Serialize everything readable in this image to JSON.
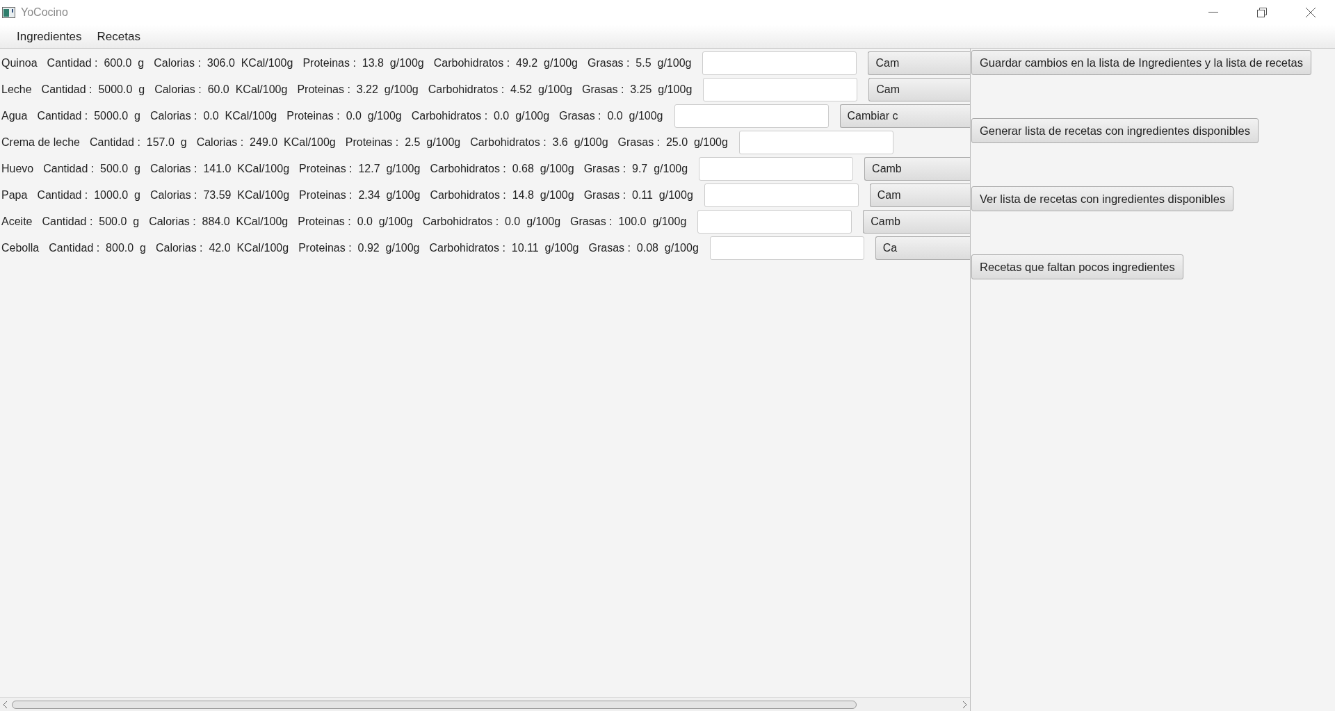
{
  "window": {
    "title": "YoCocino"
  },
  "menu": [
    "Ingredientes",
    "Recetas"
  ],
  "ingredients": [
    {
      "name": "Quinoa",
      "fields": [
        {
          "label": "Cantidad :",
          "value": "600.0",
          "unit": "g"
        },
        {
          "label": "Calorias :",
          "value": "306.0",
          "unit": "KCal/100g"
        },
        {
          "label": "Proteinas :",
          "value": "13.8",
          "unit": "g/100g"
        },
        {
          "label": "Carbohidratos :",
          "value": "49.2",
          "unit": "g/100g"
        },
        {
          "label": "Grasas :",
          "value": "5.5",
          "unit": "g/100g"
        }
      ],
      "button": "Cam"
    },
    {
      "name": "Leche",
      "fields": [
        {
          "label": "Cantidad :",
          "value": "5000.0",
          "unit": "g"
        },
        {
          "label": "Calorias :",
          "value": "60.0",
          "unit": "KCal/100g"
        },
        {
          "label": "Proteinas :",
          "value": "3.22",
          "unit": "g/100g"
        },
        {
          "label": "Carbohidratos :",
          "value": "4.52",
          "unit": "g/100g"
        },
        {
          "label": "Grasas :",
          "value": "3.25",
          "unit": "g/100g"
        }
      ],
      "button": "Cam"
    },
    {
      "name": "Agua",
      "fields": [
        {
          "label": "Cantidad :",
          "value": "5000.0",
          "unit": "g"
        },
        {
          "label": "Calorias :",
          "value": "0.0",
          "unit": "KCal/100g"
        },
        {
          "label": "Proteinas :",
          "value": "0.0",
          "unit": "g/100g"
        },
        {
          "label": "Carbohidratos :",
          "value": "0.0",
          "unit": "g/100g"
        },
        {
          "label": "Grasas :",
          "value": "0.0",
          "unit": "g/100g"
        }
      ],
      "button": "Cambiar c"
    },
    {
      "name": "Crema de leche",
      "fields": [
        {
          "label": "Cantidad :",
          "value": "157.0",
          "unit": "g"
        },
        {
          "label": "Calorias :",
          "value": "249.0",
          "unit": "KCal/100g"
        },
        {
          "label": "Proteinas :",
          "value": "2.5",
          "unit": "g/100g"
        },
        {
          "label": "Carbohidratos :",
          "value": "3.6",
          "unit": "g/100g"
        },
        {
          "label": "Grasas :",
          "value": "25.0",
          "unit": "g/100g"
        }
      ]
    },
    {
      "name": "Huevo",
      "fields": [
        {
          "label": "Cantidad :",
          "value": "500.0",
          "unit": "g"
        },
        {
          "label": "Calorias :",
          "value": "141.0",
          "unit": "KCal/100g"
        },
        {
          "label": "Proteinas :",
          "value": "12.7",
          "unit": "g/100g"
        },
        {
          "label": "Carbohidratos :",
          "value": "0.68",
          "unit": "g/100g"
        },
        {
          "label": "Grasas :",
          "value": "9.7",
          "unit": "g/100g"
        }
      ],
      "button": "Camb"
    },
    {
      "name": "Papa",
      "fields": [
        {
          "label": "Cantidad :",
          "value": "1000.0",
          "unit": "g"
        },
        {
          "label": "Calorias :",
          "value": "73.59",
          "unit": "KCal/100g"
        },
        {
          "label": "Proteinas :",
          "value": "2.34",
          "unit": "g/100g"
        },
        {
          "label": "Carbohidratos :",
          "value": "14.8",
          "unit": "g/100g"
        },
        {
          "label": "Grasas :",
          "value": "0.11",
          "unit": "g/100g"
        }
      ],
      "button": "Cam"
    },
    {
      "name": "Aceite",
      "fields": [
        {
          "label": "Cantidad :",
          "value": "500.0",
          "unit": "g"
        },
        {
          "label": "Calorias :",
          "value": "884.0",
          "unit": "KCal/100g"
        },
        {
          "label": "Proteinas :",
          "value": "0.0",
          "unit": "g/100g"
        },
        {
          "label": "Carbohidratos :",
          "value": "0.0",
          "unit": "g/100g"
        },
        {
          "label": "Grasas :",
          "value": "100.0",
          "unit": "g/100g"
        }
      ],
      "button": "Camb"
    },
    {
      "name": "Cebolla",
      "fields": [
        {
          "label": "Cantidad :",
          "value": "800.0",
          "unit": "g"
        },
        {
          "label": "Calorias :",
          "value": "42.0",
          "unit": "KCal/100g"
        },
        {
          "label": "Proteinas :",
          "value": "0.92",
          "unit": "g/100g"
        },
        {
          "label": "Carbohidratos :",
          "value": "10.11",
          "unit": "g/100g"
        },
        {
          "label": "Grasas :",
          "value": "0.08",
          "unit": "g/100g"
        }
      ],
      "button": "Ca"
    }
  ],
  "actions": [
    "Guardar cambios en la lista de Ingredientes y la lista de recetas",
    "Generar lista de recetas con ingredientes disponibles",
    "Ver lista de recetas con ingredientes disponibles",
    "Recetas que faltan pocos ingredientes"
  ]
}
